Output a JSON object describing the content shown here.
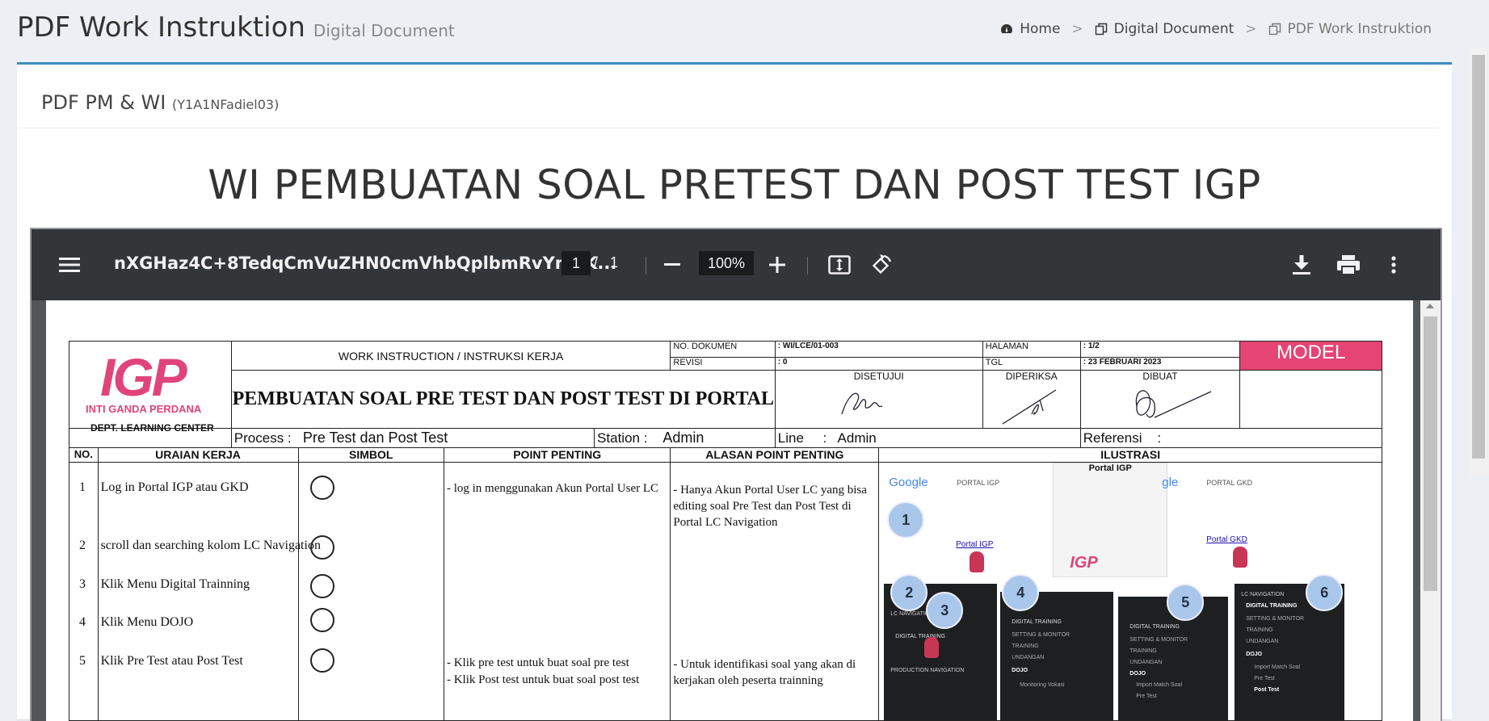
{
  "header": {
    "title": "PDF Work Instruktion",
    "subtitle": "Digital Document",
    "breadcrumb": [
      {
        "label": "Home",
        "icon": "dashboard-icon"
      },
      {
        "label": "Digital Document",
        "icon": "copy-icon"
      },
      {
        "label": "PDF Work Instruktion",
        "icon": "copy-icon"
      }
    ],
    "breadcrumb_sep": ">"
  },
  "box": {
    "title": "PDF PM & WI",
    "title_code": "(Y1A1NFadiel03)",
    "heading": "WI PEMBUATAN SOAL PRETEST DAN POST TEST IGP"
  },
  "viewer": {
    "filename": "nXGHaz4C+8TedqCmVuZHN0cmVhbQplbmRvYmoK...",
    "current_page": "1",
    "page_sep": "/",
    "total_pages": "1",
    "zoom": "100%"
  },
  "document": {
    "logo": "IGP",
    "company": "INTI GANDA PERDANA",
    "dept": "DEPT. LEARNING CENTER",
    "header_top": "WORK INSTRUCTION / INSTRUKSI KERJA",
    "title": "PEMBUATAN SOAL PRE TEST DAN POST TEST DI PORTAL",
    "no_dokumen_label": "NO. DOKUMEN",
    "no_dokumen": ": WI/LCE/01-003",
    "revisi_label": "REVISI",
    "revisi": ": 0",
    "halaman_label": "HALAMAN",
    "halaman": ": 1/2",
    "tgl_label": "TGL",
    "tgl": ": 23 FEBRUARI 2023",
    "model": "MODEL",
    "disetujui": "DISETUJUI",
    "diperiksa": "DIPERIKSA",
    "dibuat": "DIBUAT",
    "process_label": "Process :",
    "process_value": "Pre Test dan Post Test",
    "station_label": "Station :",
    "station_value": "Admin",
    "line_label": "Line",
    "line_sep": ":",
    "line_value": "Admin",
    "referensi_label": "Referensi",
    "referensi_sep": ":",
    "columns": [
      "NO.",
      "URAIAN KERJA",
      "SIMBOL",
      "POINT PENTING",
      "ALASAN POINT PENTING",
      "ILUSTRASI"
    ],
    "rows": [
      {
        "no": "1",
        "uraian": "Log in Portal IGP atau GKD",
        "point": "- log in menggunakan Akun Portal User LC",
        "alasan": "- Hanya Akun Portal User LC yang bisa editing soal Pre Test dan Post Test di Portal LC Navigation"
      },
      {
        "no": "2",
        "uraian": "scroll dan searching kolom LC Navigation",
        "point": "",
        "alasan": ""
      },
      {
        "no": "3",
        "uraian": "Klik Menu Digital Trainning",
        "point": "",
        "alasan": ""
      },
      {
        "no": "4",
        "uraian": "Klik Menu DOJO",
        "point": "",
        "alasan": ""
      },
      {
        "no": "5",
        "uraian": "Klik Pre Test atau Post Test",
        "point": "- Klik pre test untuk buat soal pre test",
        "point2": "- Klik Post test untuk buat soal post test",
        "alasan": "- Untuk identifikasi soal yang akan di kerjakan oleh peserta trainning"
      }
    ],
    "illustration": {
      "google": "Google",
      "google2": "gle",
      "portal_igp": "PORTAL IGP",
      "portal_gkd": "PORTAL GKD",
      "link_igp": "Portal IGP",
      "link_gkd": "Portal GKD",
      "popup_title": "Portal IGP",
      "logo_small": "IGP",
      "steps": [
        "1",
        "2",
        "3",
        "4",
        "5",
        "6"
      ],
      "menu_lc": "LC NAVIGATION",
      "menu_digital": "DIGITAL TRAINING",
      "menu_setting": "SETTING & MONITOR",
      "menu_training": "TRAINING",
      "menu_undangan": "UNDANGAN",
      "menu_dojo": "DOJO",
      "menu_import": "Import Match Soal",
      "menu_pretest": "Pre Test",
      "menu_posttest": "Post Test",
      "menu_production": "PRODUCTION NAVIGATION",
      "menu_monitoring": "Monitoring Vokasi"
    }
  }
}
